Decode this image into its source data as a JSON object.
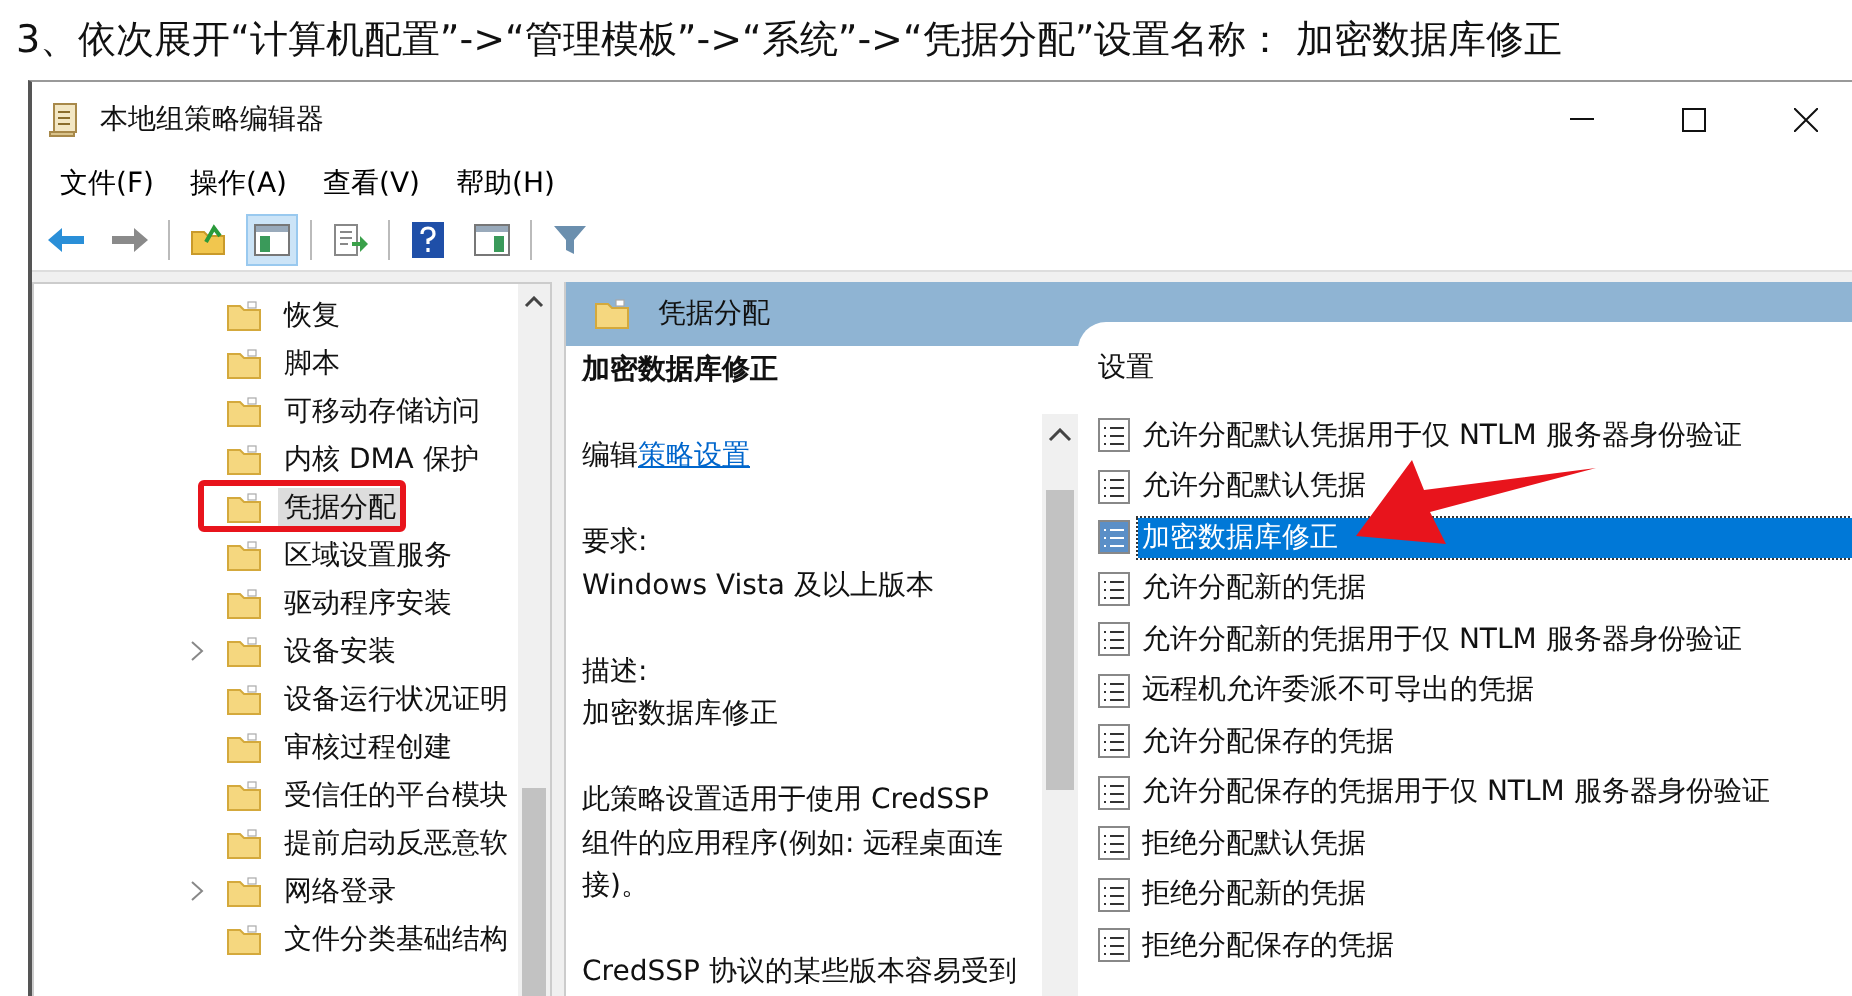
{
  "caption": "3、依次展开“计算机配置”->“管理模板”->“系统”->“凭据分配”设置名称： 加密数据库修正",
  "window": {
    "title": "本地组策略编辑器"
  },
  "menu": [
    "文件(F)",
    "操作(A)",
    "查看(V)",
    "帮助(H)"
  ],
  "tree": [
    {
      "label": "恢复",
      "expandable": false,
      "selected": false,
      "annotated": false
    },
    {
      "label": "脚本",
      "expandable": false,
      "selected": false,
      "annotated": false
    },
    {
      "label": "可移动存储访问",
      "expandable": false,
      "selected": false,
      "annotated": false
    },
    {
      "label": "内核 DMA 保护",
      "expandable": false,
      "selected": false,
      "annotated": false
    },
    {
      "label": "凭据分配",
      "expandable": false,
      "selected": true,
      "annotated": true
    },
    {
      "label": "区域设置服务",
      "expandable": false,
      "selected": false,
      "annotated": false
    },
    {
      "label": "驱动程序安装",
      "expandable": false,
      "selected": false,
      "annotated": false
    },
    {
      "label": "设备安装",
      "expandable": true,
      "selected": false,
      "annotated": false
    },
    {
      "label": "设备运行状况证明",
      "expandable": false,
      "selected": false,
      "annotated": false
    },
    {
      "label": "审核过程创建",
      "expandable": false,
      "selected": false,
      "annotated": false
    },
    {
      "label": "受信任的平台模块",
      "expandable": false,
      "selected": false,
      "annotated": false
    },
    {
      "label": "提前启动反恶意软",
      "expandable": false,
      "selected": false,
      "annotated": false
    },
    {
      "label": "网络登录",
      "expandable": true,
      "selected": false,
      "annotated": false
    },
    {
      "label": "文件分类基础结构",
      "expandable": false,
      "selected": false,
      "annotated": false
    }
  ],
  "pane_header": "凭据分配",
  "details": {
    "heading": "加密数据库修正",
    "edit_prefix": "编辑",
    "edit_link": "策略设置",
    "requirement_label": "要求:",
    "requirement": "Windows Vista 及以上版本",
    "description_label": "描述:",
    "paragraphs": [
      "加密数据库修正",
      "此策略设置适用于使用 CredSSP 组件的应用程序(例如: 远程桌面连接)。",
      "CredSSP 协议的某些版本容易受到"
    ]
  },
  "settings": {
    "header": "设置",
    "items": [
      {
        "label": "允许分配默认凭据用于仅 NTLM 服务器身份验证",
        "selected": false
      },
      {
        "label": "允许分配默认凭据",
        "selected": false
      },
      {
        "label": "加密数据库修正",
        "selected": true
      },
      {
        "label": "允许分配新的凭据",
        "selected": false
      },
      {
        "label": "允许分配新的凭据用于仅 NTLM 服务器身份验证",
        "selected": false
      },
      {
        "label": "远程机允许委派不可导出的凭据",
        "selected": false
      },
      {
        "label": "允许分配保存的凭据",
        "selected": false
      },
      {
        "label": "允许分配保存的凭据用于仅 NTLM 服务器身份验证",
        "selected": false
      },
      {
        "label": "拒绝分配默认凭据",
        "selected": false
      },
      {
        "label": "拒绝分配新的凭据",
        "selected": false
      },
      {
        "label": "拒绝分配保存的凭据",
        "selected": false
      }
    ]
  }
}
